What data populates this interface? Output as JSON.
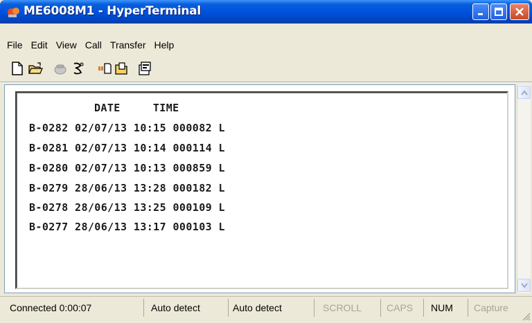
{
  "window": {
    "title": "ME6008M1 - HyperTerminal"
  },
  "menu": {
    "items": [
      "File",
      "Edit",
      "View",
      "Call",
      "Transfer",
      "Help"
    ]
  },
  "toolbar": {
    "icons": [
      "new-document-icon",
      "open-folder-icon",
      "call-phone-icon",
      "disconnect-icon",
      "send-file-icon",
      "receive-file-icon",
      "properties-icon"
    ]
  },
  "terminal": {
    "header": "DATE     TIME",
    "lines": [
      "B-0282 02/07/13 10:15 000082 L",
      "B-0281 02/07/13 10:14 000114 L",
      "B-0280 02/07/13 10:13 000859 L",
      "B-0279 28/06/13 13:28 000182 L",
      "B-0278 28/06/13 13:25 000109 L",
      "B-0277 28/06/13 13:17 000103 L"
    ]
  },
  "status": {
    "connected": "Connected 0:00:07",
    "detect1": "Auto detect",
    "detect2": "Auto detect",
    "scroll": "SCROLL",
    "caps": "CAPS",
    "num": "NUM",
    "capture": "Capture"
  },
  "colors": {
    "titlebar": "#0054e3",
    "close_button": "#c84a25",
    "terminal_text": "#1a1a1a"
  }
}
